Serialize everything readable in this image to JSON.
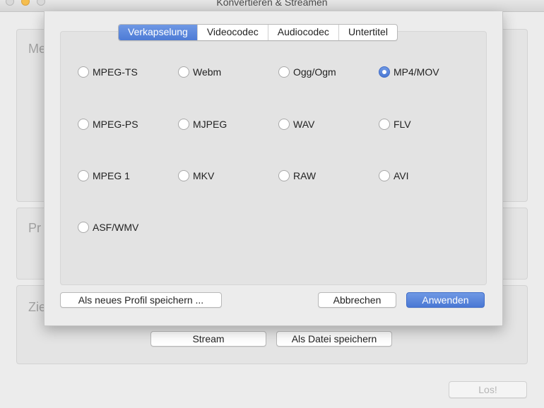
{
  "window": {
    "title": "Konvertieren & Streamen"
  },
  "background": {
    "groups": {
      "media": "Me",
      "profile": "Pr",
      "target": "Zie"
    },
    "buttons": {
      "stream": "Stream",
      "save_file": "Als Datei speichern",
      "go": "Los!"
    }
  },
  "dialog": {
    "tabs": [
      "Verkapselung",
      "Videocodec",
      "Audiocodec",
      "Untertitel"
    ],
    "active_tab": "Verkapselung",
    "formats": [
      {
        "label": "MPEG-TS",
        "checked": false
      },
      {
        "label": "Webm",
        "checked": false
      },
      {
        "label": "Ogg/Ogm",
        "checked": false
      },
      {
        "label": "MP4/MOV",
        "checked": true
      },
      {
        "label": "MPEG-PS",
        "checked": false
      },
      {
        "label": "MJPEG",
        "checked": false
      },
      {
        "label": "WAV",
        "checked": false
      },
      {
        "label": "FLV",
        "checked": false
      },
      {
        "label": "MPEG 1",
        "checked": false
      },
      {
        "label": "MKV",
        "checked": false
      },
      {
        "label": "RAW",
        "checked": false
      },
      {
        "label": "AVI",
        "checked": false
      },
      {
        "label": "ASF/WMV",
        "checked": false
      }
    ],
    "buttons": {
      "save_profile": "Als neues Profil speichern ...",
      "cancel": "Abbrechen",
      "apply": "Anwenden"
    }
  },
  "colors": {
    "accent": "#4d7bd6",
    "window_bg": "#ececec"
  }
}
